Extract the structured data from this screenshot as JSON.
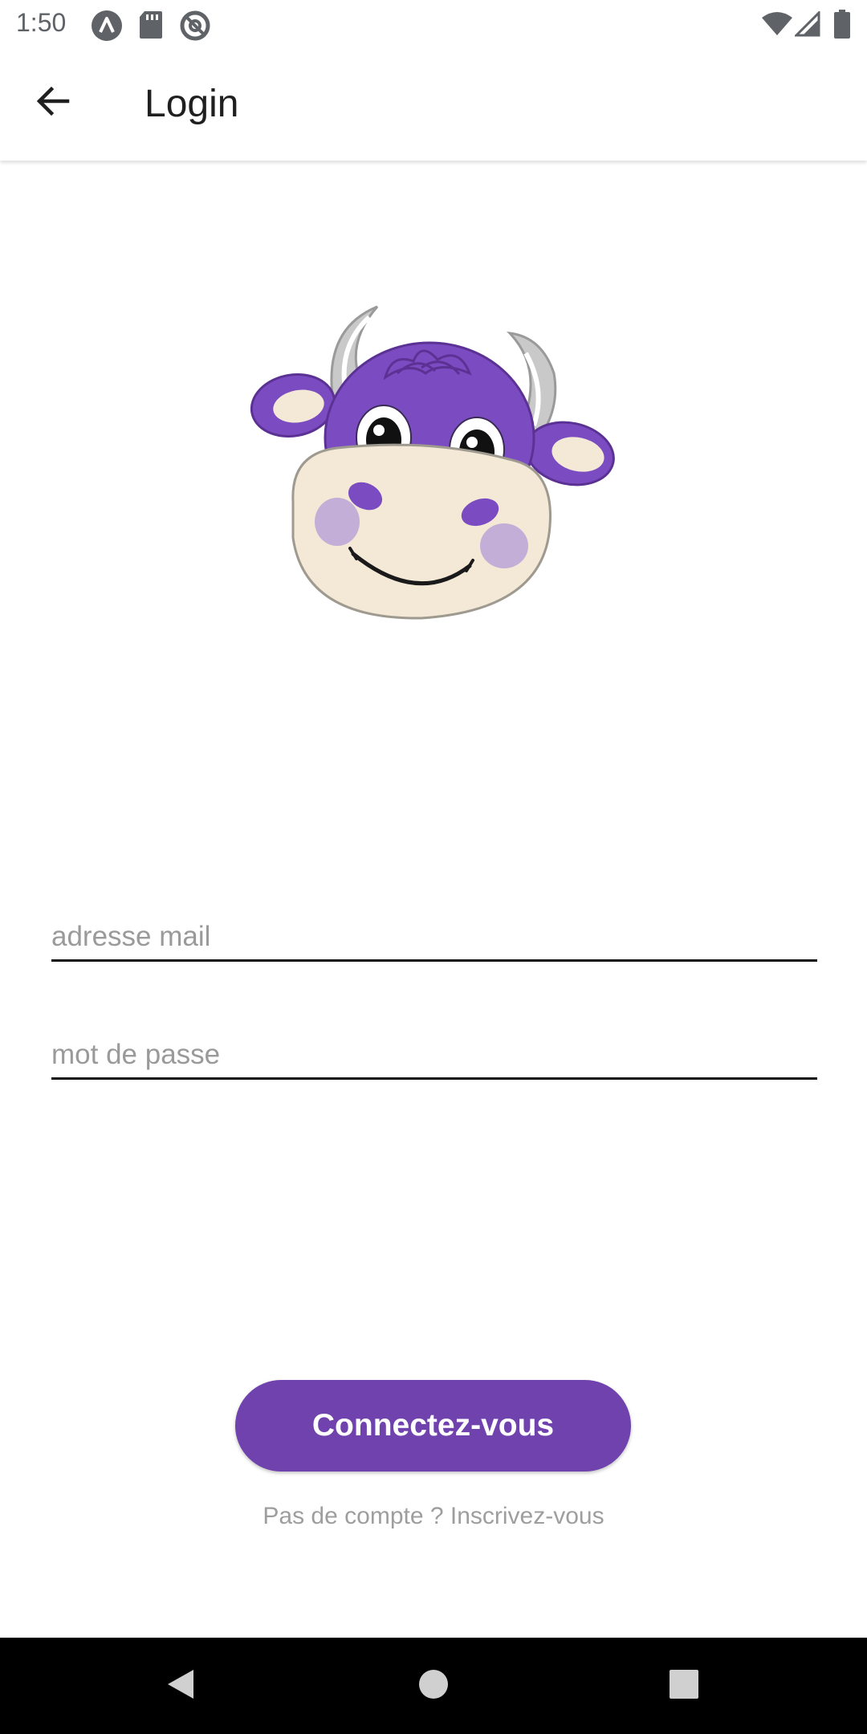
{
  "status_bar": {
    "time": "1:50",
    "left_icons": [
      "a-circle-icon",
      "sd-card-icon",
      "at-sign-icon"
    ],
    "right_icons": [
      "wifi-icon",
      "signal-icon",
      "battery-icon"
    ]
  },
  "app_bar": {
    "title": "Login",
    "back_icon": "arrow-left-icon"
  },
  "form": {
    "email_placeholder": "adresse mail",
    "email_value": "",
    "password_placeholder": "mot de passe",
    "password_value": ""
  },
  "actions": {
    "login_label": "Connectez-vous",
    "signup_text": "Pas de compte ? Inscrivez-vous"
  },
  "nav_bar": {
    "icons": [
      "back-triangle-icon",
      "home-circle-icon",
      "recents-square-icon"
    ]
  },
  "colors": {
    "accent": "#6f42ad",
    "cow_purple": "#7b4cc1",
    "cow_cream": "#f4e8d6"
  }
}
